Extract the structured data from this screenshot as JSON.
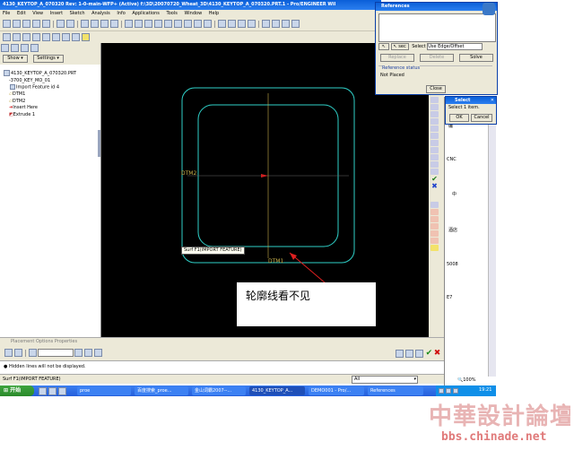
{
  "window": {
    "title": "4130_KEYTOP_A_070320 Rev: 1-0-main-WFP+ (Active) f:\\3D\\20070720_Wheat_3D\\4130_KEYTOP_A_070320.PRT.1 - Pro/ENGINEER Wil",
    "menus": [
      "File",
      "Edit",
      "View",
      "Insert",
      "Sketch",
      "Analysis",
      "Info",
      "Applications",
      "Tools",
      "Window",
      "Help"
    ]
  },
  "navigator": {
    "tabs": [
      "Show",
      "Settings"
    ],
    "tree": [
      "4130_KEYTOP_A_070320.PRT",
      "-3700_KEY_MO_01",
      "Import Feature id 4",
      "DTM1",
      "DTM2",
      "Insert Here",
      "Extrude 1"
    ]
  },
  "canvas": {
    "label_dtm2": "DTM2",
    "label_dtm1": "DTM1",
    "tooltip": "Surf F1(IMPORT FEATURE)",
    "callout": "轮廓线看不见"
  },
  "dashboard": {
    "tabs": "Placement   Options   Properties"
  },
  "status": {
    "message": "Hidden lines will not be displayed.",
    "selection": "Surf F1(IMPORT FEATURE)",
    "filter": "All"
  },
  "references_dialog": {
    "title": "References",
    "select_label": "Select",
    "select_value": "Use Edge/Offset",
    "buttons": [
      "Replace",
      "Delete",
      "Solve"
    ],
    "status_legend": "Reference status",
    "status_value": "Not Placed",
    "close": "Close"
  },
  "select_dialog": {
    "title": "Select",
    "prompt": "Select 1 item.",
    "ok": "OK",
    "cancel": "Cancel"
  },
  "bg_window": {
    "lines": [
      "编",
      "CNC",
      "中",
      "酒店",
      "5008",
      "E7"
    ],
    "zoom": "100%"
  },
  "taskbar": {
    "start": "开始",
    "tasks": [
      "proe",
      "百度搜索_proe...",
      "金山词霸2007--...",
      "4130_KEYTOP_A...",
      "DEMO001 - Pro/...",
      "References"
    ],
    "clock": "19:21"
  },
  "watermark": {
    "line1": "中華設計論壇",
    "line2": "bbs.chinade.net"
  },
  "colors": {
    "canvas": "#000000",
    "outline": "#2fd0c8",
    "titlebar": "#0a5fd8",
    "taskbar": "#245edb",
    "datum": "#c8b04a",
    "watermark": "#e07a7a"
  }
}
